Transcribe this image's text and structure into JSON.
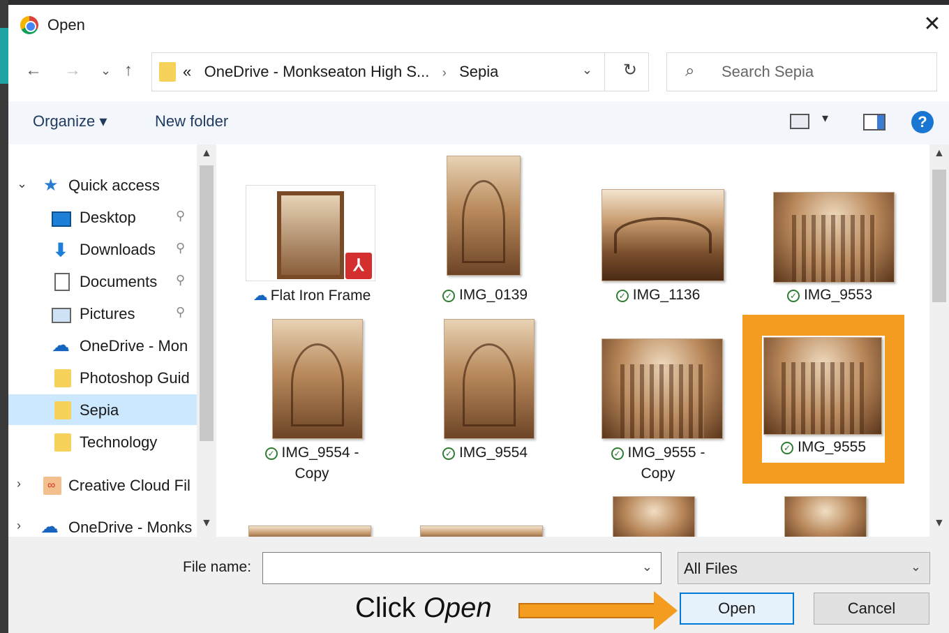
{
  "window": {
    "title": "Open",
    "close_label": "✕"
  },
  "navigation": {
    "back": "←",
    "forward": "→",
    "recent": "⌄",
    "up": "↑",
    "address": {
      "prefix": "«",
      "path": "OneDrive - Monkseaton High S...",
      "separator": "›",
      "current": "Sepia",
      "dropdown": "⌄",
      "refresh": "↻"
    },
    "search": {
      "icon": "⌕",
      "placeholder": "Search Sepia"
    }
  },
  "toolbar": {
    "organize": "Organize ▾",
    "new_folder": "New folder",
    "view_dropdown": "▾",
    "help": "?"
  },
  "sidebar": {
    "items": [
      {
        "label": "Quick access",
        "icon": "star-icon",
        "expander": "⌄",
        "pinned": false
      },
      {
        "label": "Desktop",
        "icon": "desktop-icon",
        "pinned": true
      },
      {
        "label": "Downloads",
        "icon": "download-icon",
        "pinned": true
      },
      {
        "label": "Documents",
        "icon": "document-icon",
        "pinned": true
      },
      {
        "label": "Pictures",
        "icon": "pictures-icon",
        "pinned": true
      },
      {
        "label": "OneDrive - Mon",
        "icon": "cloud-icon",
        "pinned": false
      },
      {
        "label": "Photoshop Guid",
        "icon": "folder-icon",
        "pinned": false
      },
      {
        "label": "Sepia",
        "icon": "folder-icon",
        "pinned": false,
        "selected": true
      },
      {
        "label": "Technology",
        "icon": "folder-icon",
        "pinned": false
      },
      {
        "label": "Creative Cloud Fil",
        "icon": "creative-cloud-icon",
        "expander": "›"
      },
      {
        "label": "OneDrive - Monks",
        "icon": "cloud-icon",
        "expander": "›"
      }
    ],
    "pin_glyph": "📌"
  },
  "files": [
    {
      "name": "Flat Iron Frame",
      "status": "cloud",
      "type": "pdf"
    },
    {
      "name": "IMG_0139",
      "status": "synced"
    },
    {
      "name": "IMG_1136",
      "status": "synced"
    },
    {
      "name": "IMG_9553",
      "status": "synced"
    },
    {
      "name_line1": "IMG_9554 -",
      "name_line2": "Copy",
      "status": "synced"
    },
    {
      "name": "IMG_9554",
      "status": "synced"
    },
    {
      "name_line1": "IMG_9555 -",
      "name_line2": "Copy",
      "status": "synced"
    },
    {
      "name": "IMG_9555",
      "status": "synced",
      "selected": true
    }
  ],
  "footer": {
    "file_name_label": "File name:",
    "file_name_value": "",
    "file_type": "All Files",
    "open_button": "Open",
    "cancel_button": "Cancel"
  },
  "annotation": {
    "text_prefix": "Click ",
    "text_emphasis": "Open"
  },
  "colors": {
    "highlight": "#f39c1f",
    "selection": "#cce8ff",
    "accent": "#0078d7"
  }
}
